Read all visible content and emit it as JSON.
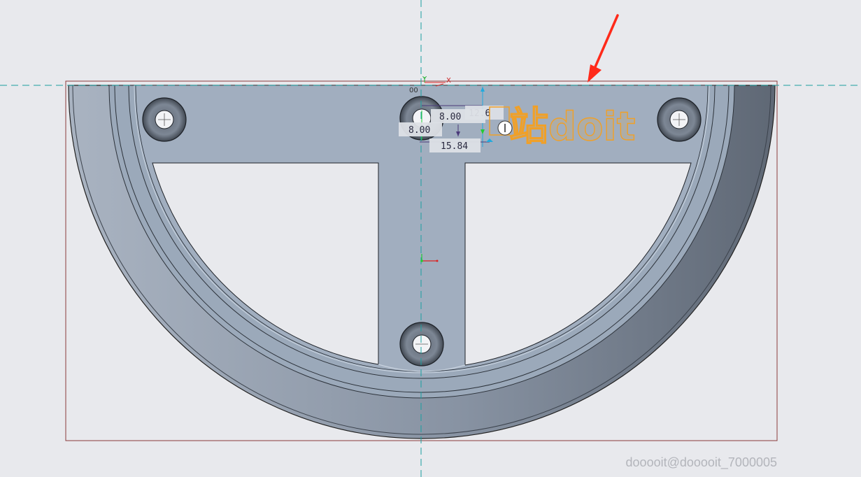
{
  "dimensions": {
    "offset_top": "8.00",
    "offset_left": "8.00",
    "vertical": "15.84",
    "partial": "12.6"
  },
  "axis": {
    "y_label": "Y",
    "x_label": "X",
    "origin_label": "00"
  },
  "watermark": {
    "brand_text": "站doit"
  },
  "footer": {
    "credit": "dooooit@dooooit_7000005"
  },
  "colors": {
    "part_body": "#9fadbe",
    "part_shadow": "#6b7684",
    "centerline": "#1aa0a0",
    "bounding_box": "#8a3a3a",
    "annotation_arrow": "#ff2a1a",
    "watermark": "#f0a028"
  }
}
